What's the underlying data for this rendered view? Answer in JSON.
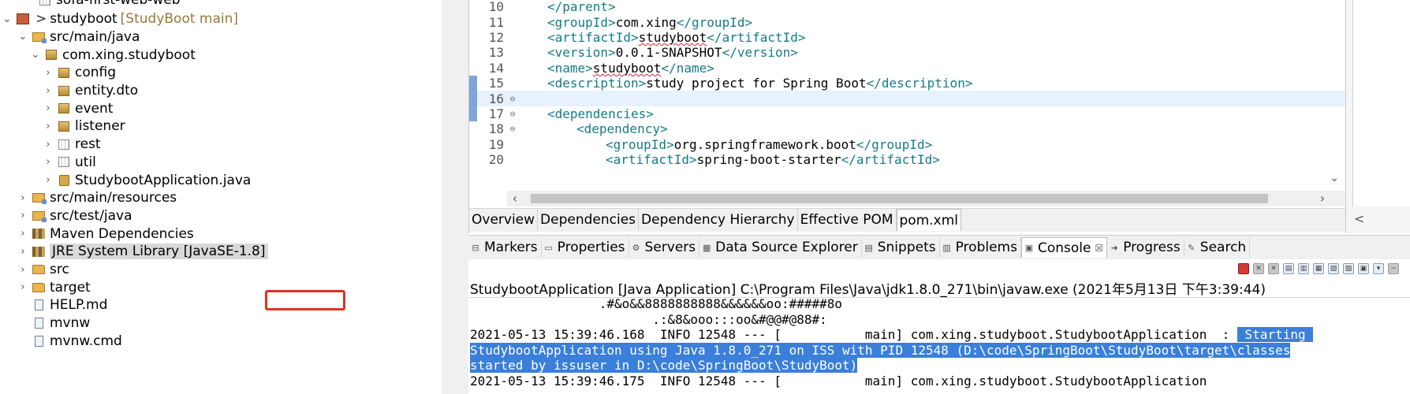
{
  "explorer": {
    "rows": [
      {
        "label": "sofa-first-web-web",
        "indent": 30,
        "chevron": "",
        "icon": "pkg-empty",
        "cut": true
      },
      {
        "label": "studyboot",
        "decor": "[StudyBoot main]",
        "indent": 2,
        "chevron": "⌄",
        "icon": "project",
        "repo": ">"
      },
      {
        "label": "src/main/java",
        "indent": 22,
        "chevron": "⌄",
        "icon": "src"
      },
      {
        "label": "com.xing.studyboot",
        "indent": 38,
        "chevron": "⌄",
        "icon": "pkg"
      },
      {
        "label": "config",
        "indent": 54,
        "chevron": "›",
        "icon": "pkg"
      },
      {
        "label": "entity.dto",
        "indent": 54,
        "chevron": "›",
        "icon": "pkg"
      },
      {
        "label": "event",
        "indent": 54,
        "chevron": "›",
        "icon": "pkg"
      },
      {
        "label": "listener",
        "indent": 54,
        "chevron": "›",
        "icon": "pkg"
      },
      {
        "label": "rest",
        "indent": 54,
        "chevron": "›",
        "icon": "pkg-empty"
      },
      {
        "label": "util",
        "indent": 54,
        "chevron": "›",
        "icon": "pkg-empty"
      },
      {
        "label": "StudybootApplication.java",
        "indent": 54,
        "chevron": "›",
        "icon": "java"
      },
      {
        "label": "src/main/resources",
        "indent": 22,
        "chevron": "›",
        "icon": "src"
      },
      {
        "label": "src/test/java",
        "indent": 22,
        "chevron": "›",
        "icon": "src"
      },
      {
        "label": "Maven Dependencies",
        "indent": 22,
        "chevron": "›",
        "icon": "lib"
      },
      {
        "label": "JRE System Library [JavaSE-1.8]",
        "indent": 22,
        "chevron": "›",
        "icon": "lib",
        "selected": true
      },
      {
        "label": "src",
        "indent": 22,
        "chevron": "›",
        "icon": "folder"
      },
      {
        "label": "target",
        "indent": 22,
        "chevron": "›",
        "icon": "folder"
      },
      {
        "label": "HELP.md",
        "indent": 22,
        "chevron": "",
        "icon": "file"
      },
      {
        "label": "mvnw",
        "indent": 22,
        "chevron": "",
        "icon": "file"
      },
      {
        "label": "mvnw.cmd",
        "indent": 22,
        "chevron": "",
        "icon": "file"
      }
    ]
  },
  "editor": {
    "lines": [
      {
        "n": "10",
        "fold": "",
        "indent": 1,
        "parts": [
          [
            "tag",
            "</parent>"
          ]
        ]
      },
      {
        "n": "11",
        "fold": "",
        "indent": 1,
        "parts": [
          [
            "tag",
            "<groupId>"
          ],
          [
            "txt",
            "com.xing"
          ],
          [
            "tag",
            "</groupId>"
          ]
        ]
      },
      {
        "n": "12",
        "fold": "",
        "indent": 1,
        "parts": [
          [
            "tag",
            "<artifactId>"
          ],
          [
            "spell",
            "studyboot"
          ],
          [
            "tag",
            "</artifactId>"
          ]
        ]
      },
      {
        "n": "13",
        "fold": "",
        "indent": 1,
        "parts": [
          [
            "tag",
            "<version>"
          ],
          [
            "txt",
            "0.0.1-SNAPSHOT"
          ],
          [
            "tag",
            "</version>"
          ]
        ]
      },
      {
        "n": "14",
        "fold": "",
        "indent": 1,
        "parts": [
          [
            "tag",
            "<name>"
          ],
          [
            "spell",
            "studyboot"
          ],
          [
            "tag",
            "</name>"
          ]
        ]
      },
      {
        "n": "15",
        "fold": "",
        "indent": 1,
        "parts": [
          [
            "tag",
            "<description>"
          ],
          [
            "txt",
            "study project for Spring Boot"
          ],
          [
            "tag",
            "</description>"
          ]
        ],
        "marker": true
      },
      {
        "n": "16",
        "fold": "⊖",
        "indent": 1,
        "parts": [],
        "current": true,
        "marker": true
      },
      {
        "n": "17",
        "fold": "⊖",
        "indent": 1,
        "parts": [
          [
            "tag",
            "<dependencies>"
          ]
        ],
        "marker": true
      },
      {
        "n": "18",
        "fold": "⊖",
        "indent": 2,
        "parts": [
          [
            "tag",
            "<dependency>"
          ]
        ]
      },
      {
        "n": "19",
        "fold": "",
        "indent": 3,
        "parts": [
          [
            "tag",
            "<groupId>"
          ],
          [
            "txt",
            "org.springframework.boot"
          ],
          [
            "tag",
            "</groupId>"
          ]
        ]
      },
      {
        "n": "20",
        "fold": "",
        "indent": 3,
        "parts": [
          [
            "tag",
            "<artifactId>"
          ],
          [
            "txt",
            "spring-boot-starter"
          ],
          [
            "tag",
            "</artifactId>"
          ]
        ]
      }
    ],
    "tabs": [
      "Overview",
      "Dependencies",
      "Dependency Hierarchy",
      "Effective POM",
      "pom.xml"
    ],
    "active_tab": 4
  },
  "views": {
    "tabs": [
      {
        "label": "Markers",
        "icon": "markers-icon",
        "glyph": "⊟"
      },
      {
        "label": "Properties",
        "icon": "properties-icon",
        "glyph": "▭"
      },
      {
        "label": "Servers",
        "icon": "servers-icon",
        "glyph": "⚙"
      },
      {
        "label": "Data Source Explorer",
        "icon": "data-source-icon",
        "glyph": "▦"
      },
      {
        "label": "Snippets",
        "icon": "snippets-icon",
        "glyph": "▤"
      },
      {
        "label": "Problems",
        "icon": "problems-icon",
        "glyph": "▥"
      },
      {
        "label": "Console",
        "icon": "console-icon",
        "glyph": "▣",
        "active": true,
        "close": "☒"
      },
      {
        "label": "Progress",
        "icon": "progress-icon",
        "glyph": "➜"
      },
      {
        "label": "Search",
        "icon": "search-icon",
        "glyph": "✎"
      }
    ]
  },
  "console": {
    "header": "StudybootApplication [Java Application] C:\\Program Files\\Java\\jdk1.8.0_271\\bin\\javaw.exe (2021年5月13日 下午3:39:44)",
    "lines": [
      {
        "segments": [
          [
            "",
            "                 .#&o&&8888888888&&&&&&oo:#####8o"
          ]
        ]
      },
      {
        "segments": [
          [
            "",
            "                        .:&8&ooo:::oo&#@@#@88#:"
          ]
        ]
      },
      {
        "segments": [
          [
            "",
            "2021-05-13 15:39:46.168  INFO 12548 --- [           main] com.xing.studyboot.StudybootApplication  : "
          ],
          [
            "sel",
            " Starting "
          ]
        ]
      },
      {
        "segments": [
          [
            "sel",
            "StudybootApplication using Java 1.8.0_271 on ISS with PID 12548 (D:\\code\\SpringBoot\\StudyBoot\\target\\classes"
          ]
        ]
      },
      {
        "segments": [
          [
            "sel",
            "started by issuser in D:\\code\\SpringBoot\\StudyBoot)"
          ]
        ]
      },
      {
        "segments": [
          [
            "",
            "2021-05-13 15:39:46.175  INFO 12548 --- [           main] com.xing.studyboot.StudybootApplication"
          ]
        ]
      }
    ]
  },
  "colors": {
    "selection": "#3a7fd9",
    "highlight_box": "#e0311f",
    "xml_tag": "#137c86"
  }
}
